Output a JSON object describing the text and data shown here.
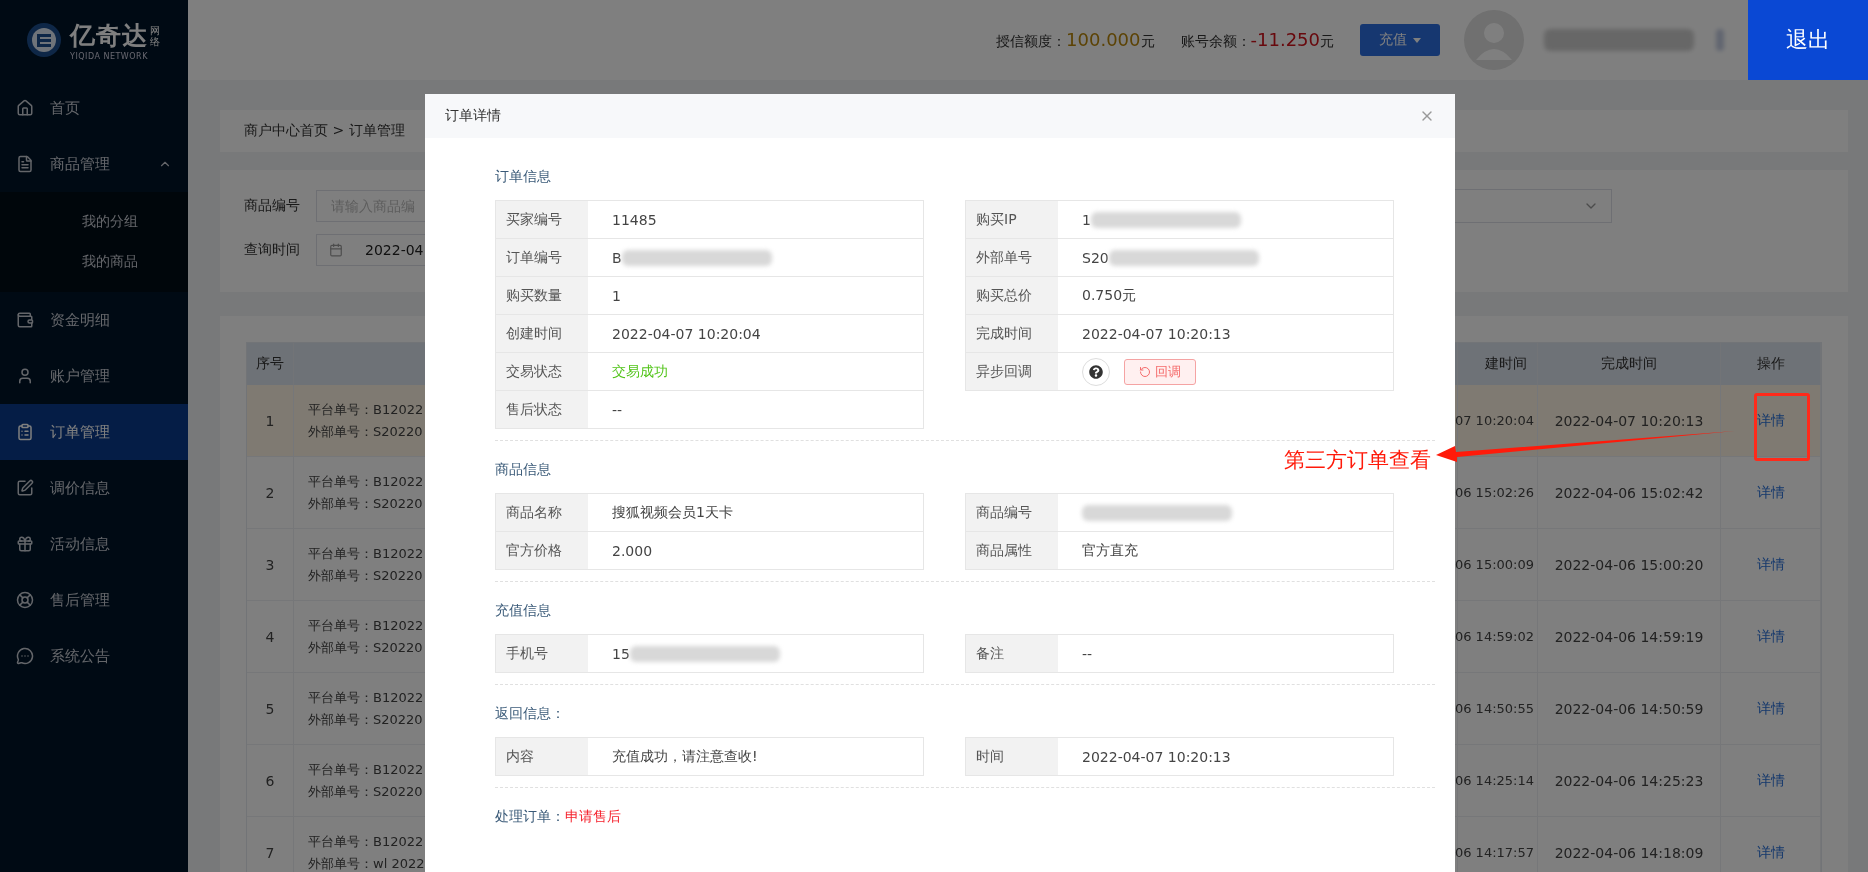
{
  "sidebar": {
    "logo": {
      "name": "亿奇达",
      "tag": "网络",
      "subtitle": "YIQIDA NETWORK"
    },
    "items": [
      {
        "label": "首页",
        "selected": false
      },
      {
        "label": "商品管理",
        "selected": false,
        "expanded": true,
        "children": [
          {
            "label": "我的分组",
            "selected": false
          },
          {
            "label": "我的商品",
            "selected": false
          }
        ]
      },
      {
        "label": "资金明细",
        "selected": false
      },
      {
        "label": "账户管理",
        "selected": false
      },
      {
        "label": "订单管理",
        "selected": true
      },
      {
        "label": "调价信息",
        "selected": false
      },
      {
        "label": "活动信息",
        "selected": false
      },
      {
        "label": "售后管理",
        "selected": false
      },
      {
        "label": "系统公告",
        "selected": false
      }
    ]
  },
  "header": {
    "credit_label": "授信额度：",
    "credit_value": "100.000",
    "credit_unit": "元",
    "balance_label": "账号余额：",
    "balance_value": "-11.250",
    "balance_unit": "元",
    "recharge_button": "充值",
    "logout_button": "退出"
  },
  "breadcrumb": {
    "items": [
      "商户中心首页",
      "订单管理"
    ],
    "separator": ">"
  },
  "filters": {
    "product_code": {
      "label": "商品编号",
      "placeholder": "请输入商品编"
    },
    "query_time": {
      "label": "查询时间",
      "value": "2022-04"
    }
  },
  "table": {
    "columns": [
      "序号",
      "建时间",
      "完成时间",
      "操作"
    ],
    "rows": [
      {
        "index": "1",
        "platform_no": "平台单号：B12022",
        "external_no": "外部单号：S20220",
        "created": "07 10:20:04",
        "completed": "2022-04-07 10:20:13",
        "action": "详情",
        "selected": true
      },
      {
        "index": "2",
        "platform_no": "平台单号：B12022",
        "external_no": "外部单号：S20220",
        "created": "06 15:02:26",
        "completed": "2022-04-06 15:02:42",
        "action": "详情",
        "selected": false
      },
      {
        "index": "3",
        "platform_no": "平台单号：B12022",
        "external_no": "外部单号：S20220",
        "created": "06 15:00:09",
        "completed": "2022-04-06 15:00:20",
        "action": "详情",
        "selected": false
      },
      {
        "index": "4",
        "platform_no": "平台单号：B12022",
        "external_no": "外部单号：S20220",
        "created": "06 14:59:02",
        "completed": "2022-04-06 14:59:19",
        "action": "详情",
        "selected": false
      },
      {
        "index": "5",
        "platform_no": "平台单号：B12022",
        "external_no": "外部单号：S20220",
        "created": "06 14:50:55",
        "completed": "2022-04-06 14:50:59",
        "action": "详情",
        "selected": false
      },
      {
        "index": "6",
        "platform_no": "平台单号：B12022",
        "external_no": "外部单号：S20220",
        "created": "06 14:25:14",
        "completed": "2022-04-06 14:25:23",
        "action": "详情",
        "selected": false
      },
      {
        "index": "7",
        "platform_no": "平台单号：B12022",
        "external_no": "外部单号：wl 2022",
        "created": "06 14:17:57",
        "completed": "2022-04-06 14:18:09",
        "action": "详情",
        "selected": false
      }
    ]
  },
  "modal": {
    "title": "订单详情",
    "sections": [
      {
        "title": "订单信息",
        "left": [
          {
            "label": "买家编号",
            "kind": "text",
            "value": "11485"
          },
          {
            "label": "订单编号",
            "kind": "redacted",
            "value": "B"
          },
          {
            "label": "购买数量",
            "kind": "text",
            "value": "1"
          },
          {
            "label": "创建时间",
            "kind": "text",
            "value": "2022-04-07 10:20:04"
          },
          {
            "label": "交易状态",
            "kind": "status",
            "value": "交易成功"
          },
          {
            "label": "售后状态",
            "kind": "text",
            "value": "--"
          }
        ],
        "right": [
          {
            "label": "购买IP",
            "kind": "redacted",
            "value": "1"
          },
          {
            "label": "外部单号",
            "kind": "redacted",
            "value": "S20"
          },
          {
            "label": "购买总价",
            "kind": "text",
            "value": "0.750元"
          },
          {
            "label": "完成时间",
            "kind": "text",
            "value": "2022-04-07 10:20:13"
          },
          {
            "label": "异步回调",
            "kind": "callback",
            "value": "回调"
          }
        ]
      },
      {
        "title": "商品信息",
        "left": [
          {
            "label": "商品名称",
            "kind": "text",
            "value": "搜狐视频会员1天卡"
          },
          {
            "label": "官方价格",
            "kind": "text",
            "value": "2.000"
          }
        ],
        "right": [
          {
            "label": "商品编号",
            "kind": "redacted"
          },
          {
            "label": "商品属性",
            "kind": "text",
            "value": "官方直充"
          }
        ]
      },
      {
        "title": "充值信息",
        "left": [
          {
            "label": "手机号",
            "kind": "redacted",
            "value": "15"
          }
        ],
        "right": [
          {
            "label": "备注",
            "kind": "text",
            "value": "--"
          }
        ]
      },
      {
        "title": "返回信息：",
        "left": [
          {
            "label": "内容",
            "kind": "text",
            "value": "充值成功，请注意查收!"
          }
        ],
        "right": [
          {
            "label": "时间",
            "kind": "text",
            "value": "2022-04-07 10:20:13"
          }
        ]
      }
    ],
    "footer": {
      "label": "处理订单：",
      "action": "申请售后"
    }
  },
  "annotation": {
    "label": "第三方订单查看"
  }
}
